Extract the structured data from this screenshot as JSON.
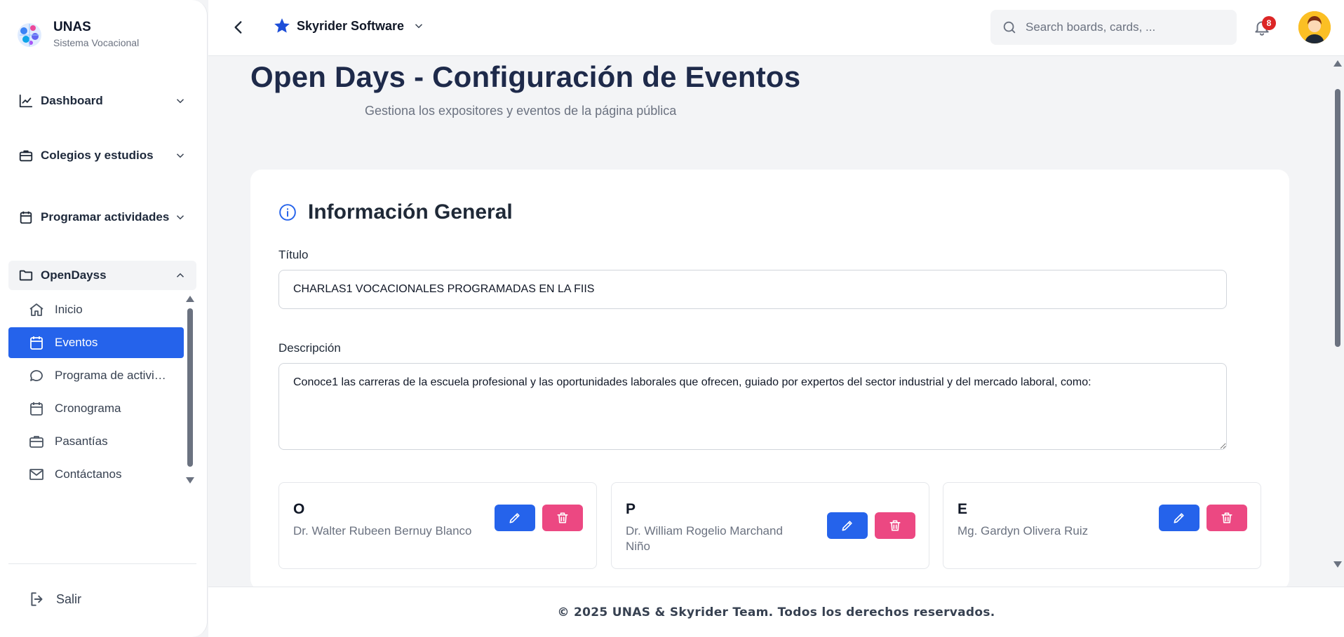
{
  "brand": {
    "name": "UNAS",
    "subtitle": "Sistema Vocacional"
  },
  "sidebar": {
    "groups": [
      {
        "label": "Dashboard",
        "icon": "chart-line-icon"
      },
      {
        "label": "Colegios y estudios",
        "icon": "briefcase-icon"
      },
      {
        "label": "Programar actividades",
        "icon": "calendar-icon"
      },
      {
        "label": "OpenDayss",
        "icon": "folder-icon"
      }
    ],
    "items": [
      {
        "label": "Inicio",
        "icon": "home-icon"
      },
      {
        "label": "Eventos",
        "icon": "calendar-icon"
      },
      {
        "label": "Programa de actividades",
        "icon": "chat-icon"
      },
      {
        "label": "Cronograma",
        "icon": "calendar-icon"
      },
      {
        "label": "Pasantías",
        "icon": "briefcase-icon"
      },
      {
        "label": "Contáctanos",
        "icon": "mail-icon"
      }
    ],
    "logout_label": "Salir"
  },
  "topbar": {
    "workspace": "Skyrider Software",
    "search_placeholder": "Search boards, cards, ...",
    "notifications_count": "8"
  },
  "page": {
    "title": "Open Days - Configuración de Eventos",
    "subtitle": "Gestiona los expositores y eventos de la página pública"
  },
  "card": {
    "heading": "Información General",
    "title_label": "Título",
    "title_value": "CHARLAS1 VOCACIONALES PROGRAMADAS EN LA FIIS",
    "description_label": "Descripción",
    "description_value": "Conoce1 las carreras de la escuela profesional y las oportunidades laborales que ofrecen, guiado por expertos del sector industrial y del mercado laboral, como:"
  },
  "speakers": [
    {
      "letter": "O",
      "name": "Dr. Walter Rubeen Bernuy Blanco"
    },
    {
      "letter": "P",
      "name": "Dr. William Rogelio Marchand Niño"
    },
    {
      "letter": "E",
      "name": "Mg. Gardyn Olivera Ruiz"
    }
  ],
  "footer": {
    "text": "© 2025 UNAS & Skyrider Team. Todos los derechos reservados."
  },
  "colors": {
    "primary": "#2563eb",
    "danger": "#ec4882",
    "title": "#1e2a4a"
  }
}
